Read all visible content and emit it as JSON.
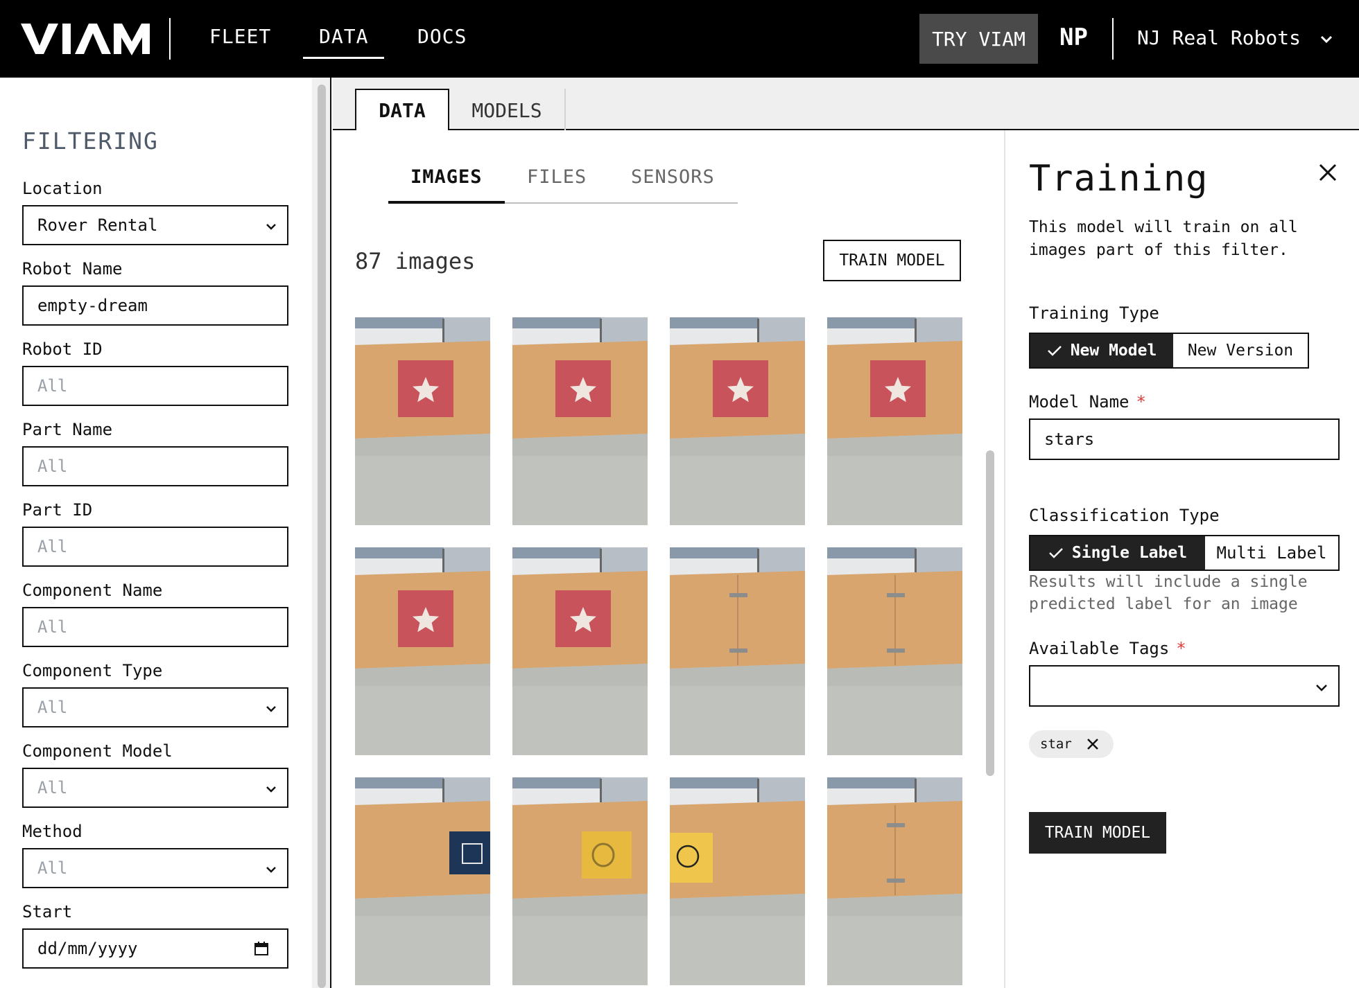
{
  "nav": {
    "logo_alt": "VIAM",
    "links": [
      "FLEET",
      "DATA",
      "DOCS"
    ],
    "active_link": "DATA",
    "try_button": "TRY VIAM",
    "org_initials": "NP",
    "org_name": "NJ Real Robots"
  },
  "filtering": {
    "title": "FILTERING",
    "fields": [
      {
        "label": "Location",
        "value": "Rover Rental",
        "kind": "select"
      },
      {
        "label": "Robot Name",
        "value": "empty-dream",
        "kind": "text"
      },
      {
        "label": "Robot ID",
        "placeholder": "All",
        "kind": "text"
      },
      {
        "label": "Part Name",
        "placeholder": "All",
        "kind": "text"
      },
      {
        "label": "Part ID",
        "placeholder": "All",
        "kind": "text"
      },
      {
        "label": "Component Name",
        "placeholder": "All",
        "kind": "text"
      },
      {
        "label": "Component Type",
        "placeholder": "All",
        "kind": "select"
      },
      {
        "label": "Component Model",
        "placeholder": "All",
        "kind": "select"
      },
      {
        "label": "Method",
        "placeholder": "All",
        "kind": "select"
      },
      {
        "label": "Start",
        "placeholder": "dd/mm/yyyy",
        "kind": "date"
      }
    ]
  },
  "main_tabs": {
    "data": "DATA",
    "models": "MODELS",
    "active": "DATA"
  },
  "sub_tabs": {
    "images": "IMAGES",
    "files": "FILES",
    "sensors": "SENSORS",
    "active": "IMAGES"
  },
  "images": {
    "count_label": "87 images",
    "train_button": "TRAIN MODEL",
    "thumbnails": [
      {
        "kind": "red-star"
      },
      {
        "kind": "red-star"
      },
      {
        "kind": "red-star"
      },
      {
        "kind": "red-star"
      },
      {
        "kind": "red-star"
      },
      {
        "kind": "red-star"
      },
      {
        "kind": "plain-wall"
      },
      {
        "kind": "plain-wall"
      },
      {
        "kind": "navy-square"
      },
      {
        "kind": "yellow-circle-blur"
      },
      {
        "kind": "yellow-circle"
      },
      {
        "kind": "plain-wall"
      }
    ]
  },
  "training": {
    "title": "Training",
    "description": "This model will train on all images part of this filter.",
    "training_type_label": "Training Type",
    "training_type_options": [
      "New Model",
      "New Version"
    ],
    "training_type_selected": "New Model",
    "model_name_label": "Model Name",
    "required_mark": "*",
    "model_name_value": "stars",
    "classification_type_label": "Classification Type",
    "classification_options": [
      "Single Label",
      "Multi Label"
    ],
    "classification_selected": "Single Label",
    "classification_help": "Results will include a single predicted label for an image",
    "available_tags_label": "Available Tags",
    "available_tags_value": "",
    "selected_tags": [
      "star"
    ],
    "train_button": "TRAIN MODEL"
  },
  "colors": {
    "nav_bg": "#000000",
    "try_bg": "#4a4a4a",
    "filled_button_bg": "#222222",
    "required": "#e23b3b",
    "filter_title": "#4e5a6a",
    "star_card": "#c9535a",
    "wood": "#d7a56d"
  }
}
